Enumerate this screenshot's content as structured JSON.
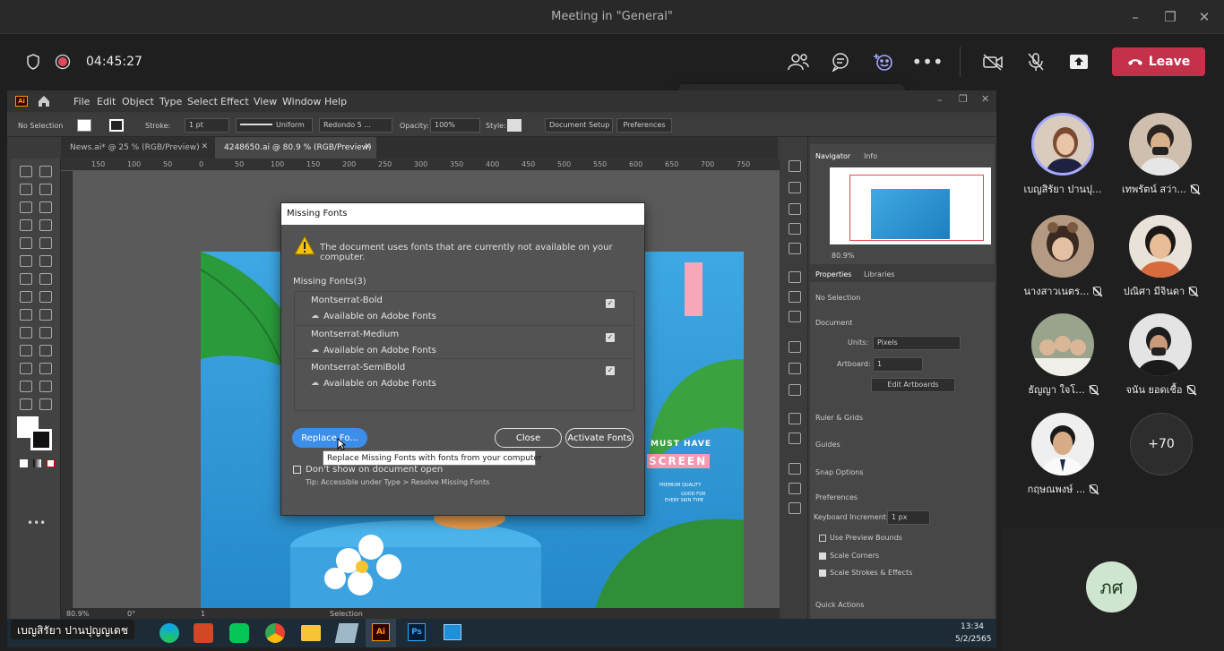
{
  "window": {
    "title": "Meeting in \"General\""
  },
  "meeting": {
    "timer": "04:45:27",
    "leave_label": "Leave",
    "reactions": [
      "👍",
      "❤️",
      "👏",
      "😄",
      "😮",
      "✋"
    ]
  },
  "illustrator": {
    "app_badge": "Ai",
    "menu": [
      "File",
      "Edit",
      "Object",
      "Type",
      "Select",
      "Effect",
      "View",
      "Window",
      "Help"
    ],
    "control": {
      "selection": "No Selection",
      "stroke_label": "Stroke:",
      "stroke_value": "1 pt",
      "profile": "Uniform",
      "brush": "Redondo 5 ...",
      "opacity_label": "Opacity:",
      "opacity_value": "100%",
      "style_label": "Style:",
      "doc_setup": "Document Setup",
      "preferences": "Preferences"
    },
    "tabs": [
      "News.ai* @ 25 % (RGB/Preview)",
      "4248650.ai @ 80.9 % (RGB/Preview)"
    ],
    "ruler_ticks": [
      "150",
      "100",
      "50",
      "0",
      "50",
      "100",
      "150",
      "200",
      "250",
      "300",
      "350",
      "400",
      "450",
      "500",
      "550",
      "600",
      "650",
      "700",
      "750"
    ],
    "status": {
      "zoom": "80.9%",
      "angle": "0°",
      "artboard": "1",
      "mode": "Selection"
    },
    "artwork": {
      "headline1": "MUST HAVE",
      "headline2": "SCREEN",
      "sub1": "PREMIUM QUALITY",
      "sub2": "GOOD FOR",
      "sub3": "EVERY SKIN TYPE"
    },
    "panel": {
      "tabs_top": [
        "Navigator",
        "Info"
      ],
      "zoom": "80.9%",
      "tabs_bottom": [
        "Properties",
        "Libraries"
      ],
      "no_selection": "No Selection",
      "document": "Document",
      "units_label": "Units:",
      "units_value": "Pixels",
      "artboard_label": "Artboard:",
      "artboard_value": "1",
      "edit_artboards": "Edit Artboards",
      "ruler_grids": "Ruler & Grids",
      "guides": "Guides",
      "snap": "Snap Options",
      "preferences": "Preferences",
      "kbd_label": "Keyboard Increment:",
      "kbd_value": "1 px",
      "opt1": "Use Preview Bounds",
      "opt2": "Scale Corners",
      "opt3": "Scale Strokes & Effects",
      "quick_actions": "Quick Actions"
    },
    "dialog": {
      "title": "Missing Fonts",
      "message": "The document uses fonts that are currently not available on your computer.",
      "list_header": "Missing Fonts(3)",
      "fonts": [
        {
          "name": "Montserrat-Bold",
          "status": "Available on Adobe Fonts"
        },
        {
          "name": "Montserrat-Medium",
          "status": "Available on Adobe Fonts"
        },
        {
          "name": "Montserrat-SemiBold",
          "status": "Available on Adobe Fonts"
        }
      ],
      "replace": "Replace Fo...",
      "close": "Close",
      "activate": "Activate Fonts",
      "tooltip": "Replace Missing Fonts with fonts from your computer",
      "dont_show": "Don't show on document open",
      "tip": "Tip: Accessible under Type > Resolve Missing Fonts"
    }
  },
  "taskbar": {
    "time": "13:34",
    "date": "5/2/2565",
    "apps": [
      "Ps",
      "Ai"
    ]
  },
  "participants": [
    {
      "name": "เบญสิรัยา ปานปุ..."
    },
    {
      "name": "เทพรัตน์ สว่า..."
    },
    {
      "name": "นางสาวเนตร..."
    },
    {
      "name": "ปณิศา มีจินดา"
    },
    {
      "name": "ธัญญา ใจโ..."
    },
    {
      "name": "จนัน ยอดเชื้อ"
    },
    {
      "name": "กฤษณพงษ์ ..."
    }
  ],
  "more_count": "+70",
  "self": {
    "initials": "ภศ"
  },
  "speaker": {
    "name": "เบญสิรัยา ปานปุญญเดช"
  }
}
